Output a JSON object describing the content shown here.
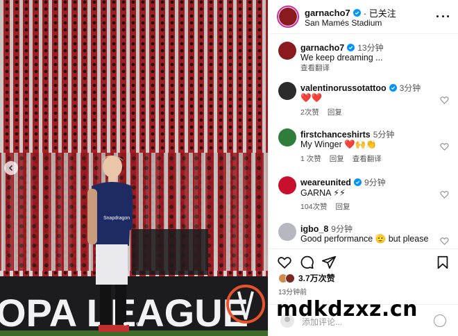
{
  "post": {
    "username": "garnacho7",
    "follow_status": "· 已关注",
    "location": "San Mamés Stadium",
    "caption": {
      "username": "garnacho7",
      "time": "13分钟",
      "text": "We keep dreaming ...",
      "translate": "查看翻译"
    }
  },
  "photo": {
    "banner_text": "OPA LEAGUE",
    "player_sponsor": "Snapdragon"
  },
  "comments": [
    {
      "username": "valentinorussotattoo",
      "verified": true,
      "time": "3分钟",
      "text": "❤️❤️",
      "likes": "2次赞",
      "reply": "回复",
      "translate": ""
    },
    {
      "username": "firstchanceshirts",
      "verified": false,
      "time": "5分钟",
      "text": "My Winger ❤️🙌👏",
      "likes": "1 次赞",
      "reply": "回复",
      "translate": "查看翻译"
    },
    {
      "username": "weareunited",
      "verified": true,
      "time": "9分钟",
      "text": "GARNA ⚡⚡",
      "likes": "104次赞",
      "reply": "回复",
      "translate": ""
    },
    {
      "username": "igbo_8",
      "verified": false,
      "time": "9分钟",
      "text": "Good performance 🫡 but please",
      "likes": "",
      "reply": "",
      "translate": ""
    }
  ],
  "likes_text": "3.7万次赞",
  "posted_time": "13分钟前",
  "add_comment_placeholder": "添加评论...",
  "watermark": "mdkdzxz.cn",
  "colors": {
    "accent": "#0095f6",
    "heart_red": "#e0245e",
    "crowd_red": "#c8242b"
  }
}
